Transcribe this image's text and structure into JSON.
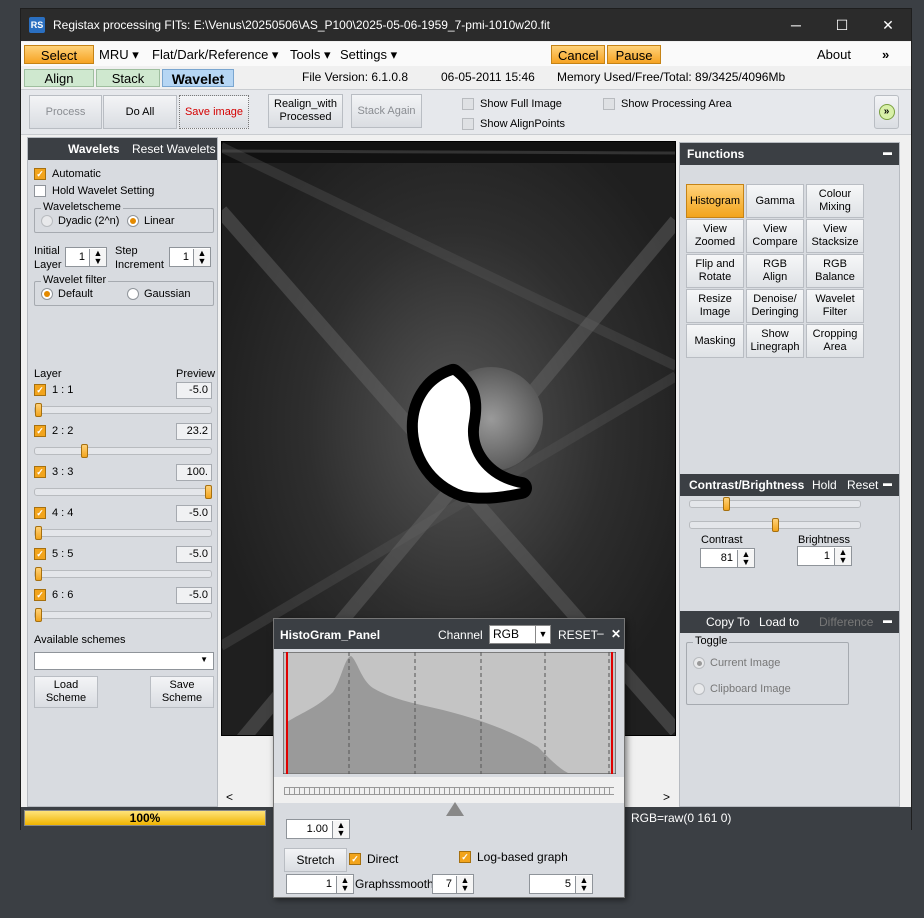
{
  "title": "Registax processing FITs: E:\\Venus\\20250506\\AS_P100\\2025-05-06-1959_7-pmi-1010w20.fit",
  "app_icon": "RS",
  "window_controls": {
    "minimize": "─",
    "maximize": "☐",
    "close": "✕",
    "overflow": "»"
  },
  "menu": {
    "select": "Select",
    "mru": "MRU ▾",
    "flat": "Flat/Dark/Reference ▾",
    "tools": "Tools ▾",
    "settings": "Settings ▾",
    "cancel": "Cancel",
    "pause": "Pause",
    "about": "About"
  },
  "tabs": {
    "align": "Align",
    "stack": "Stack",
    "wavelet": "Wavelet"
  },
  "info": {
    "file_version": "File Version: 6.1.0.8",
    "date": "06-05-2011 15:46",
    "memory": "Memory Used/Free/Total: 89/3425/4096Mb"
  },
  "toolbar": {
    "process": "Process",
    "do_all": "Do All",
    "save_image": "Save image",
    "realign_line1": "Realign_with",
    "realign_line2": "Processed",
    "stack_again": "Stack Again",
    "show_full_image": "Show Full Image",
    "show_align_points": "Show AlignPoints",
    "show_processing_area": "Show Processing Area",
    "expand": "»"
  },
  "wavelets": {
    "header": "Wavelets",
    "reset": "Reset Wavelets",
    "automatic": "Automatic",
    "hold": "Hold Wavelet Setting",
    "scheme_group": "Waveletscheme",
    "dyadic": "Dyadic (2^n)",
    "linear": "Linear",
    "initial_layer_1": "Initial",
    "initial_layer_2": "Layer",
    "initial_layer_value": "1",
    "step_increment_1": "Step",
    "step_increment_2": "Increment",
    "step_increment_value": "1",
    "filter_group": "Wavelet filter",
    "default": "Default",
    "gaussian": "Gaussian",
    "layer_header": "Layer",
    "preview_header": "Preview",
    "layers": [
      {
        "label": "1 : 1",
        "value": "-5.0",
        "position": 0.0
      },
      {
        "label": "2 : 2",
        "value": "23.2",
        "position": 0.27
      },
      {
        "label": "3 : 3",
        "value": "100.",
        "position": 1.0
      },
      {
        "label": "4 : 4",
        "value": "-5.0",
        "position": 0.0
      },
      {
        "label": "5 : 5",
        "value": "-5.0",
        "position": 0.0
      },
      {
        "label": "6 : 6",
        "value": "-5.0",
        "position": 0.0
      }
    ],
    "available_schemes": "Available schemes",
    "load_1": "Load",
    "load_2": "Scheme",
    "save_1": "Save",
    "save_2": "Scheme"
  },
  "functions": {
    "header": "Functions",
    "collapse": "▬",
    "buttons": [
      [
        "Histogram",
        ""
      ],
      [
        "Gamma",
        ""
      ],
      [
        "Colour",
        "Mixing"
      ],
      [
        "View",
        "Zoomed"
      ],
      [
        "View",
        "Compare"
      ],
      [
        "View",
        "Stacksize"
      ],
      [
        "Flip and",
        "Rotate"
      ],
      [
        "RGB",
        "Align"
      ],
      [
        "RGB",
        "Balance"
      ],
      [
        "Resize",
        "Image"
      ],
      [
        "Denoise/",
        "Deringing"
      ],
      [
        "Wavelet",
        "Filter"
      ],
      [
        "Masking",
        ""
      ],
      [
        "Show",
        "Linegraph"
      ],
      [
        "Cropping",
        "Area"
      ]
    ]
  },
  "contrast": {
    "header": "Contrast/Brightness",
    "hold": "Hold",
    "reset": "Reset",
    "contrast_label": "Contrast",
    "contrast_value": "81",
    "contrast_position": 0.2,
    "brightness_label": "Brightness",
    "brightness_value": "1",
    "brightness_position": 0.5
  },
  "copy": {
    "copy_to": "Copy To",
    "load_to": "Load to",
    "difference": "Difference",
    "toggle": "Toggle",
    "current": "Current Image",
    "clipboard": "Clipboard Image"
  },
  "status": {
    "progress": "100%",
    "progress_fraction": 1.0,
    "rgb": "RGB=raw(0 161 0)"
  },
  "histogram": {
    "title": "HistoGram_Panel",
    "channel_label": "Channel",
    "channel_value": "RGB",
    "reset": "RESET",
    "minimize": "‒",
    "close": "✕",
    "gamma_value": "1.00",
    "stretch": "Stretch",
    "direct": "Direct",
    "log_graph": "Log-based graph",
    "left_value": "1",
    "graphsmooth_label": "Graphssmooth",
    "graphsmooth_value": "7",
    "right_value": "5"
  },
  "colors": {
    "accent": "#f2a41c",
    "title_bg": "#2b2b2b",
    "panel_header": "#3b3f44",
    "histogram_fill": "#9a9a9a",
    "histogram_marker": "#e00000",
    "save_red": "#d40000"
  },
  "scroll": {
    "left": "<",
    "right": ">"
  }
}
